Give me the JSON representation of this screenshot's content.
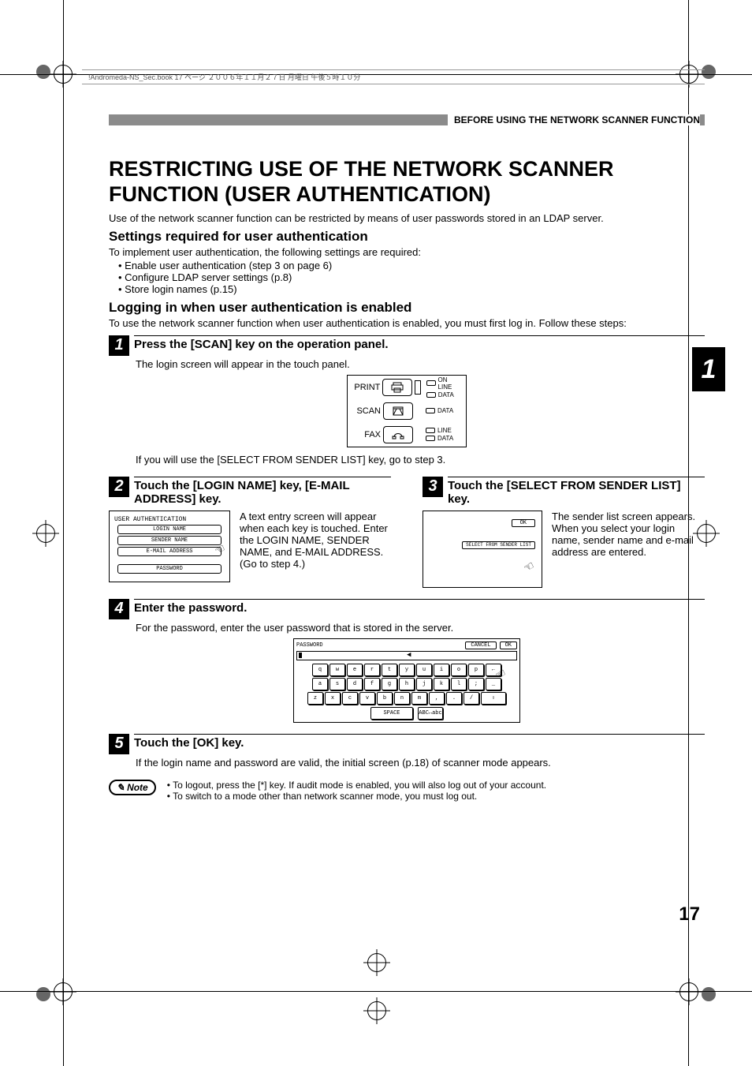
{
  "print_header": "!Andromeda-NS_Sec.book  17 ページ   ２００６年１１月２７日   月曜日   午後５時１０分",
  "running_head": "BEFORE USING THE NETWORK SCANNER FUNCTION",
  "chapter_tab": "1",
  "page_number": "17",
  "title": "RESTRICTING USE OF THE NETWORK SCANNER FUNCTION (USER AUTHENTICATION)",
  "intro": "Use of the network scanner function can be restricted by means of user passwords stored in an LDAP server.",
  "section1": {
    "heading": "Settings required for user authentication",
    "lead": "To implement user authentication, the following settings are required:",
    "bullets": [
      "Enable user authentication (step 3 on page 6)",
      "Configure LDAP server settings (p.8)",
      "Store login names (p.15)"
    ]
  },
  "section2": {
    "heading": "Logging in when user authentication is enabled",
    "lead": "To use the network scanner function when user authentication is enabled, you must first log in. Follow these steps:"
  },
  "step1": {
    "num": "1",
    "title": "Press the [SCAN] key on the operation panel.",
    "body": "The login screen will appear in the touch panel.",
    "after": "If you will use the [SELECT FROM SENDER LIST] key, go to step 3.",
    "panel": {
      "rows": [
        {
          "label": "PRINT",
          "lights": [
            "ON LINE",
            "DATA"
          ]
        },
        {
          "label": "SCAN",
          "lights": [
            "DATA"
          ]
        },
        {
          "label": "FAX",
          "lights": [
            "LINE",
            "DATA"
          ]
        }
      ]
    }
  },
  "step2": {
    "num": "2",
    "title": "Touch the [LOGIN NAME] key, [E-MAIL ADDRESS] key.",
    "body": "A text entry screen will appear when each key is touched. Enter the LOGIN NAME, SENDER NAME, and E-MAIL ADDRESS. (Go to step 4.)",
    "auth_title": "USER AUTHENTICATION",
    "fields": [
      "LOGIN NAME",
      "SENDER NAME",
      "E-MAIL ADDRESS"
    ],
    "password_label": "PASSWORD"
  },
  "step3": {
    "num": "3",
    "title": "Touch the [SELECT FROM SENDER LIST] key.",
    "body": "The sender list screen appears. When you select your login name, sender name and e-mail address are entered.",
    "ok_label": "OK",
    "sfl_label": "SELECT FROM\nSENDER LIST"
  },
  "step4": {
    "num": "4",
    "title": "Enter the password.",
    "body": "For the password, enter the user password that is stored in the server.",
    "kb": {
      "header": "PASSWORD",
      "cancel": "CANCEL",
      "ok": "OK",
      "rows": [
        [
          "q",
          "w",
          "e",
          "r",
          "t",
          "y",
          "u",
          "i",
          "o",
          "p",
          "←"
        ],
        [
          "a",
          "s",
          "d",
          "f",
          "g",
          "h",
          "j",
          "k",
          "l",
          ";",
          "_"
        ],
        [
          "z",
          "x",
          "c",
          "v",
          "b",
          "n",
          "m",
          ",",
          ".",
          "/"
        ]
      ],
      "space": "SPACE",
      "mode": "ABC↔abc"
    }
  },
  "step5": {
    "num": "5",
    "title": "Touch the [OK] key.",
    "body": "If the login name and password are valid, the initial screen (p.18) of scanner mode appears."
  },
  "note": {
    "label": "Note",
    "items": [
      "To logout, press the [*] key. If audit mode is enabled, you will also log out of your account.",
      "To switch to a mode other than network scanner mode, you must log out."
    ]
  }
}
